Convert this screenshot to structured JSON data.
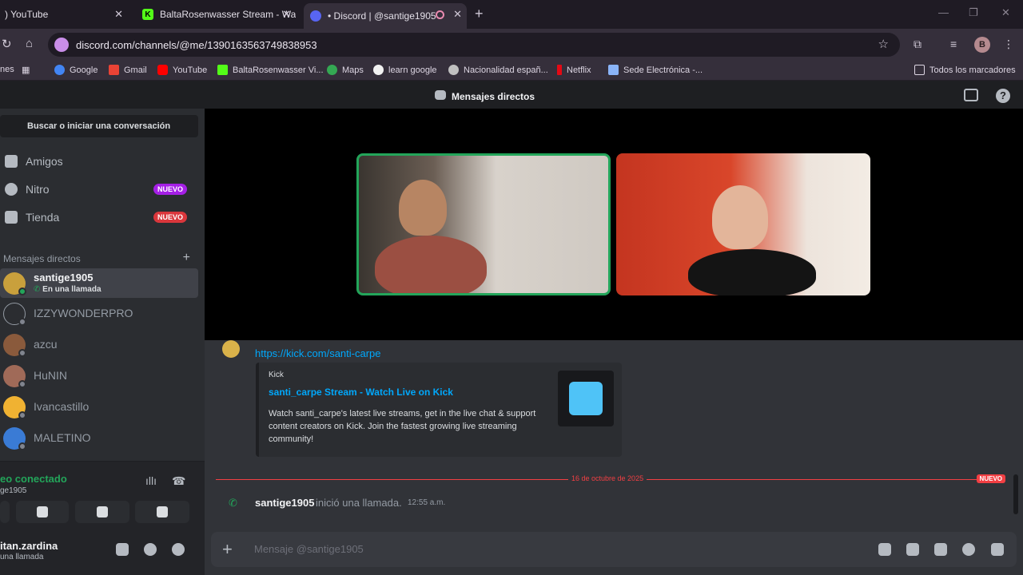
{
  "browser": {
    "tabs": [
      {
        "label": ") YouTube",
        "color": "#ff0000"
      },
      {
        "label": "BaltaRosenwasser Stream - Wa",
        "color": "#53fc18"
      },
      {
        "label": "• Discord | @santige1905",
        "color": "#5865f2"
      }
    ],
    "new_tab": "+",
    "url": "discord.com/channels/@me/1390163563749838953",
    "profile_initial": "B",
    "bookmarks": [
      "nes",
      "Google",
      "Gmail",
      "YouTube",
      "BaltaRosenwasser Vi...",
      "Maps",
      "learn google",
      "Nacionalidad españ...",
      "Netflix",
      "Sede Electrónica -..."
    ],
    "all_bookmarks": "Todos los marcadores"
  },
  "discord": {
    "title": "Mensajes directos",
    "search": "Buscar o iniciar una conversación",
    "nav": [
      {
        "label": "Amigos",
        "badge": ""
      },
      {
        "label": "Nitro",
        "badge": "NUEVO"
      },
      {
        "label": "Tienda",
        "badge": "NUEVO"
      }
    ],
    "dm_header": "Mensajes directos",
    "dms": [
      {
        "name": "santige1905",
        "sub": "En una llamada",
        "avatar": "#c9a03c",
        "online": true
      },
      {
        "name": "IZZYWONDERPRO",
        "sub": "",
        "avatar": "#2b2d31",
        "online": false
      },
      {
        "name": "azcu",
        "sub": "",
        "avatar": "#8a5a3c",
        "online": false
      },
      {
        "name": "HuNIN",
        "sub": "",
        "avatar": "#a06a58",
        "online": false
      },
      {
        "name": "Ivancastillo",
        "sub": "",
        "avatar": "#f0b232",
        "online": false
      },
      {
        "name": "MALETINO",
        "sub": "",
        "avatar": "#3a7bd5",
        "online": false
      }
    ],
    "voice": {
      "status": "eo conectado",
      "channel": "ge1905"
    },
    "user": {
      "name": "itan.zardina",
      "status": "una llamada"
    },
    "message": {
      "link": "https://kick.com/santi-carpe",
      "embed_provider": "Kick",
      "embed_title": "santi_carpe Stream - Watch Live on Kick",
      "embed_description": "Watch santi_carpe's latest live streams, get in the live chat & support content creators on Kick. Join the fastest growing live streaming community!"
    },
    "divider_date": "16 de octubre de 2025",
    "new_badge": "NUEVO",
    "call": {
      "user": "santige1905",
      "text": "inició una llamada.",
      "time": "12:55 a.m."
    },
    "composer_placeholder": "Mensaje @santige1905"
  }
}
